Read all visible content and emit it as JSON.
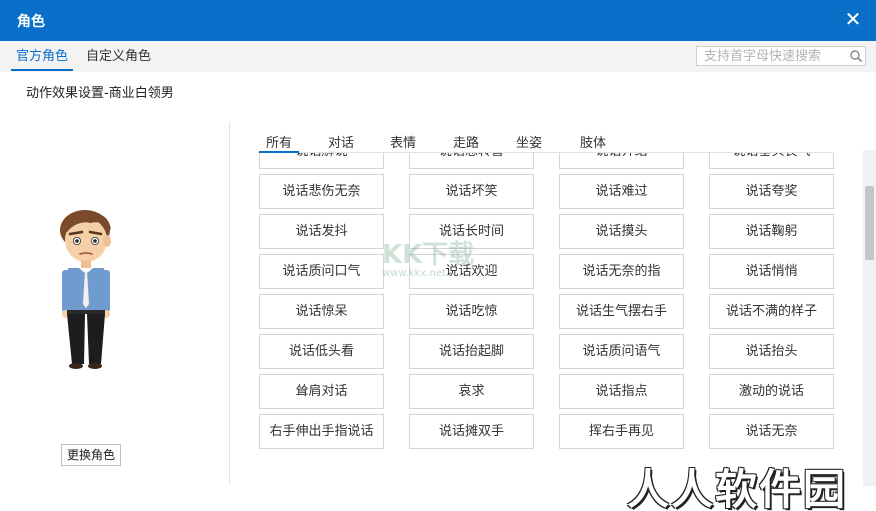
{
  "window": {
    "title": "角色",
    "close_icon": "close-icon"
  },
  "tabs": [
    {
      "label": "官方角色",
      "active": true
    },
    {
      "label": "自定义角色",
      "active": false
    }
  ],
  "search": {
    "placeholder": "支持首字母快速搜索",
    "value": "",
    "icon": "search-icon"
  },
  "subtitle": "动作效果设置-商业白领男",
  "left_panel": {
    "change_button": "更换角色",
    "avatar": "businessman-avatar"
  },
  "categories": [
    {
      "label": "所有",
      "active": true
    },
    {
      "label": "对话",
      "active": false
    },
    {
      "label": "表情",
      "active": false
    },
    {
      "label": "走路",
      "active": false
    },
    {
      "label": "坐姿",
      "active": false
    },
    {
      "label": "肢体",
      "active": false
    }
  ],
  "action_rows": [
    [
      "说话解说",
      "说话悲转喜",
      "说话介绍",
      "说话垂头丧气"
    ],
    [
      "说话悲伤无奈",
      "说话坏笑",
      "说话难过",
      "说话夸奖"
    ],
    [
      "说话发抖",
      "说话长时间",
      "说话摸头",
      "说话鞠躬"
    ],
    [
      "说话质问口气",
      "说话欢迎",
      "说话无奈的指",
      "说话悄悄"
    ],
    [
      "说话惊呆",
      "说话吃惊",
      "说话生气摆右手",
      "说话不满的样子"
    ],
    [
      "说话低头看",
      "说话抬起脚",
      "说话质问语气",
      "说话抬头"
    ],
    [
      "耸肩对话",
      "哀求",
      "说话指点",
      "激动的说话"
    ],
    [
      "右手伸出手指说话",
      "说话摊双手",
      "挥右手再见",
      "说话无奈"
    ]
  ],
  "watermarks": {
    "center_big": "KK下载",
    "center_small": "www.kkx.net",
    "corner": "人人软件园"
  },
  "colors": {
    "accent": "#0a6fc9",
    "titlebar": "#0a6fc9",
    "border": "#d5d5d5"
  }
}
